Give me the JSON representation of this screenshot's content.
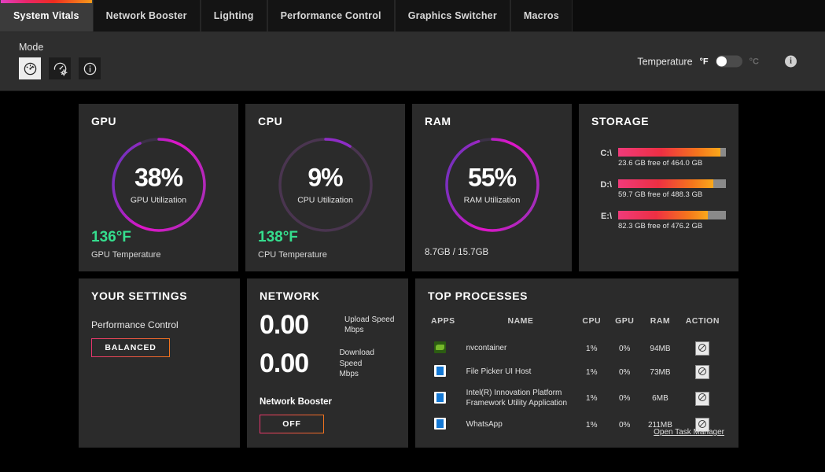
{
  "tabs": [
    {
      "label": "System Vitals",
      "active": true
    },
    {
      "label": "Network Booster",
      "active": false
    },
    {
      "label": "Lighting",
      "active": false
    },
    {
      "label": "Performance Control",
      "active": false
    },
    {
      "label": "Graphics Switcher",
      "active": false
    },
    {
      "label": "Macros",
      "active": false
    }
  ],
  "modebar": {
    "label": "Mode",
    "icons": [
      {
        "name": "gauge-icon",
        "active": true
      },
      {
        "name": "gauge-settings-icon",
        "active": false
      },
      {
        "name": "info-circle-icon",
        "active": false
      }
    ],
    "temperature_label": "Temperature",
    "unit_fahrenheit": "°F",
    "unit_celsius": "°C",
    "selected_unit": "°F",
    "info_glyph": "i"
  },
  "gpu": {
    "title": "GPU",
    "percent_label": "38%",
    "percent_value": 38,
    "utilization_caption": "GPU Utilization",
    "temperature": "136°F",
    "temperature_caption": "GPU Temperature"
  },
  "cpu": {
    "title": "CPU",
    "percent_label": "9%",
    "percent_value": 9,
    "utilization_caption": "CPU Utilization",
    "temperature": "138°F",
    "temperature_caption": "CPU Temperature"
  },
  "ram": {
    "title": "RAM",
    "percent_label": "55%",
    "percent_value": 55,
    "utilization_caption": "RAM Utilization",
    "usage": "8.7GB / 15.7GB"
  },
  "storage": {
    "title": "STORAGE",
    "drives": [
      {
        "letter": "C:\\",
        "text": "23.6 GB free of 464.0 GB",
        "used_percent": 95
      },
      {
        "letter": "D:\\",
        "text": "59.7 GB free of 488.3 GB",
        "used_percent": 88
      },
      {
        "letter": "E:\\",
        "text": "82.3 GB free of 476.2 GB",
        "used_percent": 83
      }
    ]
  },
  "settings": {
    "title": "YOUR SETTINGS",
    "item_label": "Performance Control",
    "item_value": "BALANCED"
  },
  "network": {
    "title": "NETWORK",
    "upload_value": "0.00",
    "upload_label": "Upload Speed",
    "upload_unit": "Mbps",
    "download_value": "0.00",
    "download_label": "Download Speed",
    "download_unit": "Mbps",
    "booster_label": "Network Booster",
    "booster_state": "OFF"
  },
  "processes": {
    "title": "TOP PROCESSES",
    "columns": {
      "apps": "APPS",
      "name": "NAME",
      "cpu": "CPU",
      "gpu": "GPU",
      "ram": "RAM",
      "action": "ACTION"
    },
    "rows": [
      {
        "icon": "nvidia-app-icon",
        "icon_style": "green",
        "name": "nvcontainer",
        "cpu": "1%",
        "gpu": "0%",
        "ram": "94MB",
        "action": "ban-icon"
      },
      {
        "icon": "window-app-icon",
        "icon_style": "win",
        "name": "File Picker UI Host",
        "cpu": "1%",
        "gpu": "0%",
        "ram": "73MB",
        "action": "ban-icon"
      },
      {
        "icon": "window-app-icon",
        "icon_style": "win",
        "name": "Intel(R) Innovation Platform Framework Utility Application",
        "cpu": "1%",
        "gpu": "0%",
        "ram": "6MB",
        "action": "ban-icon"
      },
      {
        "icon": "window-app-icon",
        "icon_style": "win",
        "name": "WhatsApp",
        "cpu": "1%",
        "gpu": "0%",
        "ram": "211MB",
        "action": "ban-icon"
      }
    ],
    "task_manager_link": "Open Task Manager"
  },
  "colors": {
    "accent_magenta": "#e040c0",
    "accent_red": "#ef2b1f",
    "accent_orange": "#f59a1a",
    "gauge_purple": "#7b2fbe",
    "gauge_magenta": "#e015c8",
    "temp_green": "#35de8e",
    "card_bg": "#2b2b2b",
    "page_bg": "#000000"
  }
}
